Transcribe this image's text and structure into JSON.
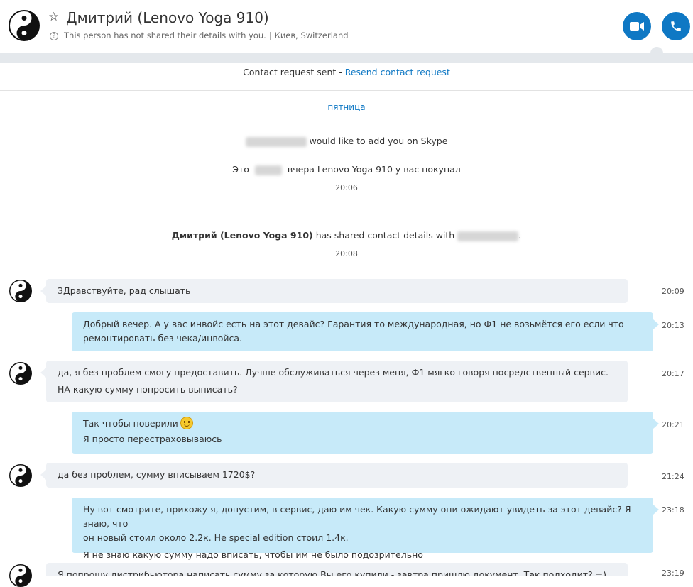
{
  "header": {
    "contact_name": "Дмитрий (Lenovo Yoga 910)",
    "details_text": "This person has not shared their details with you.",
    "location": "Киев, Switzerland",
    "help_icon_glyph": "?",
    "video_call_icon": "video-camera-icon",
    "audio_call_icon": "phone-icon",
    "accent_color": "#0f78c4"
  },
  "request_bar": {
    "sent_text": "Contact request sent - ",
    "resend_link": "Resend contact request"
  },
  "conversation": {
    "day_label": "пятница",
    "system_messages": [
      {
        "suffix": "would like to add you on Skype"
      },
      {
        "prefix": "Это",
        "suffix": "вчера Lenovo Yoga 910 у вас покупал",
        "time": "20:06"
      },
      {
        "name": "Дмитрий (Lenovo Yoga 910)",
        "middle": "has shared contact details with",
        "end": ".",
        "time": "20:08"
      }
    ],
    "messages": [
      {
        "direction": "in",
        "lines": [
          "ЗДравствуйте, рад слышать"
        ],
        "time": "20:09"
      },
      {
        "direction": "out",
        "lines": [
          "Добрый вечер. А у вас инвойс есть на этот девайс? Гарантия то международная, но Ф1 не возьмётся его если что",
          "ремонтировать без чека/инвойса."
        ],
        "time": "20:13"
      },
      {
        "direction": "in",
        "lines": [
          "да, я без проблем смогу предоставить. Лучше обслуживаться через меня, Ф1 мягко говоря посредственный сервис.",
          "НА какую сумму попросить выписать?"
        ],
        "time": "20:17"
      },
      {
        "direction": "out",
        "lines": [
          "Так чтобы поверили",
          "Я просто перестраховываюсь"
        ],
        "emoji": "smiley-emoji",
        "time": "20:21"
      },
      {
        "direction": "in",
        "lines": [
          "да без проблем, сумму вписываем 1720$?"
        ],
        "time": "21:24"
      },
      {
        "direction": "out",
        "lines": [
          "Ну вот смотрите, прихожу я, допустим, в сервис, даю им чек. Какую сумму они ожидают увидеть за этот девайс? Я знаю, что",
          "он новый стоил около 2.2к. Не special edition стоил 1.4к.",
          "Я не знаю какую сумму надо вписать, чтобы им не было подозрительно"
        ],
        "time": "23:18"
      },
      {
        "direction": "in",
        "lines": [
          "Я попрошу дистрибьютора написать сумму за которую Вы его купили - завтра пришлю документ. Так подходит? =)"
        ],
        "time": "23:19"
      }
    ]
  }
}
